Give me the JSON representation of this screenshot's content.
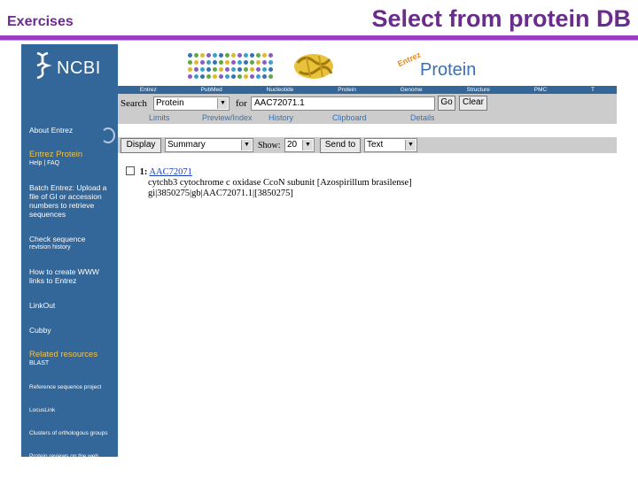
{
  "slide": {
    "label": "Exercises",
    "title": "Select from protein DB"
  },
  "colors": {
    "accent": "#9a3cc4",
    "sidebar": "#336699",
    "link": "#1a3fb0"
  },
  "ncbi": {
    "logo_text": "NCBI"
  },
  "banner": {
    "entrez_text": "Entrez",
    "protein_text": "Protein"
  },
  "nav": [
    "Entrez",
    "PubMed",
    "Nucleotide",
    "Protein",
    "Genome",
    "Structure",
    "PMC",
    "T"
  ],
  "search": {
    "label": "Search",
    "db": "Protein",
    "for_label": "for",
    "query": "AAC72071.1",
    "go": "Go",
    "clear": "Clear"
  },
  "tabs": [
    "Limits",
    "Preview/Index",
    "History",
    "Clipboard",
    "Details"
  ],
  "display": {
    "button": "Display",
    "format": "Summary",
    "show_label": "Show:",
    "show_value": "20",
    "send_button": "Send to",
    "send_format": "Text"
  },
  "sidebar": [
    {
      "label": "About Entrez",
      "hdr": false
    },
    {
      "label": "Entrez Protein",
      "sub": "Help | FAQ",
      "hdr": true
    },
    {
      "label": "Batch Entrez: Upload a file of GI or accession numbers to retrieve sequences",
      "hdr": false
    },
    {
      "label": "Check sequence",
      "sub": "revision history",
      "hdr": false
    },
    {
      "label": "How to create WWW links to Entrez",
      "hdr": false
    },
    {
      "label": "LinkOut",
      "hdr": false
    },
    {
      "label": "Cubby",
      "hdr": false
    },
    {
      "label": "Related resources",
      "sub": "BLAST",
      "hdr": true
    },
    {
      "label": "Reference sequence project",
      "hdr": false,
      "small": true
    },
    {
      "label": "LocusLink",
      "hdr": false,
      "small": true
    },
    {
      "label": "Clusters of orthologous groups",
      "hdr": false,
      "small": true
    },
    {
      "label": "Protein reviews on the web",
      "hdr": false,
      "small": true
    }
  ],
  "result": {
    "index": "1:",
    "accession": "AAC72071",
    "description": "cytchb3 cytochrome c oxidase CcoN subunit [Azospirillum brasilense]",
    "ids": "gi|3850275|gb|AAC72071.1|[3850275]"
  }
}
